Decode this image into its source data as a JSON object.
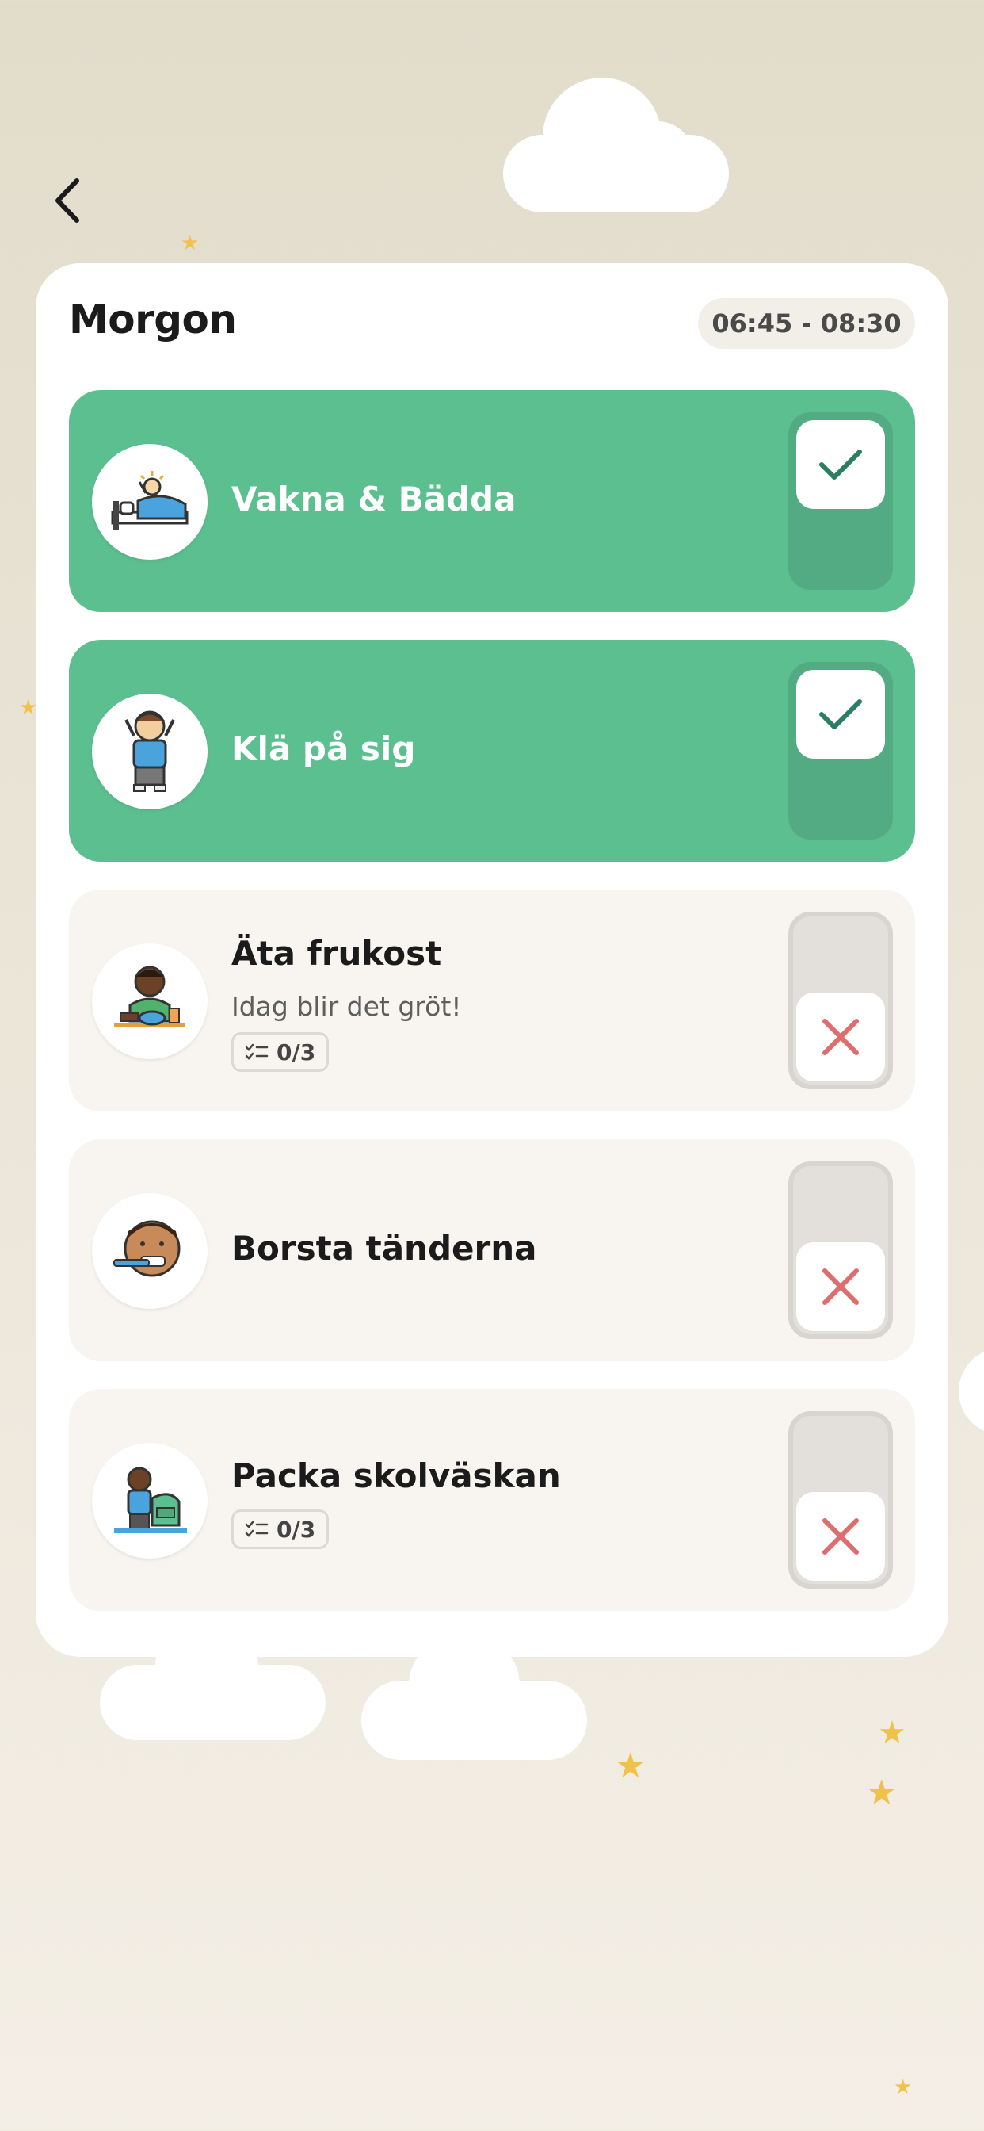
{
  "header": {
    "back_icon": "chevron-left-icon"
  },
  "routine": {
    "title": "Morgon",
    "time_range": "06:45 - 08:30"
  },
  "tasks": [
    {
      "label": "Vakna & Bädda",
      "status": "done",
      "icon": "wake-up-make-bed-icon"
    },
    {
      "label": "Klä på sig",
      "status": "done",
      "icon": "get-dressed-icon"
    },
    {
      "label": "Äta frukost",
      "subtitle": "Idag blir det gröt!",
      "checklist": "0/3",
      "status": "not-done",
      "icon": "eat-breakfast-icon"
    },
    {
      "label": "Borsta tänderna",
      "status": "not-done",
      "icon": "brush-teeth-icon"
    },
    {
      "label": "Packa skolväskan",
      "checklist": "0/3",
      "status": "not-done",
      "icon": "pack-school-bag-icon"
    }
  ],
  "colors": {
    "done_background": "#5cbf8f",
    "done_toggle": "#52ab82",
    "check_mark": "#2a7f62",
    "cross_mark": "#e06c6c",
    "star": "#f1c24a"
  }
}
